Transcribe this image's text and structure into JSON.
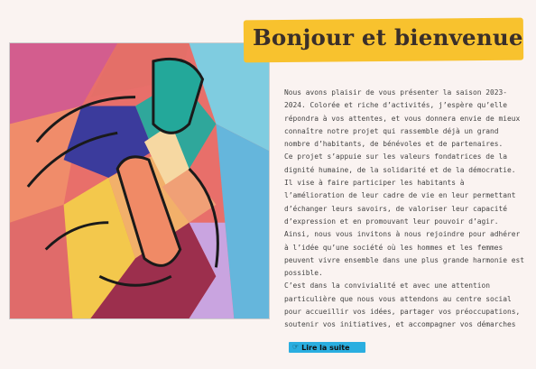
{
  "header": {
    "title": "Bonjour et bienvenue"
  },
  "intro": {
    "paragraphs": [
      "Nous avons plaisir de vous présenter la saison 2023-2024. Colorée et riche d’activités, j’espère qu’elle répondra à vos attentes, et vous donnera envie de mieux connaître notre projet qui rassemble déjà un grand nombre d’habitants, de bénévoles et de partenaires.",
      "Ce projet s’appuie sur les valeurs fondatrices de la dignité humaine, de la solidarité et de la démocratie.",
      "Il vise à faire participer les habitants à l’amélioration de leur cadre de vie en leur permettant d’échanger leurs savoirs, de valoriser leur capacité d’expression et en promouvant leur pouvoir d’agir.",
      "Ainsi, nous vous invitons à nous rejoindre pour adhérer à l’idée qu’une société où les hommes et les femmes peuvent vivre ensemble dans une plus grande harmonie est possible.",
      "C’est dans la convivialité et avec une attention particulière que nous vous attendons au centre social pour accueillir vos idées, partager vos préoccupations, soutenir vos initiatives, et accompagner vos démarches"
    ]
  },
  "read_more": {
    "label": "Lire la suite",
    "icon": "hand-pointing-right-icon"
  },
  "colors": {
    "banner": "#f8c22e",
    "button": "#2aaee0",
    "background": "#faf3f1"
  }
}
